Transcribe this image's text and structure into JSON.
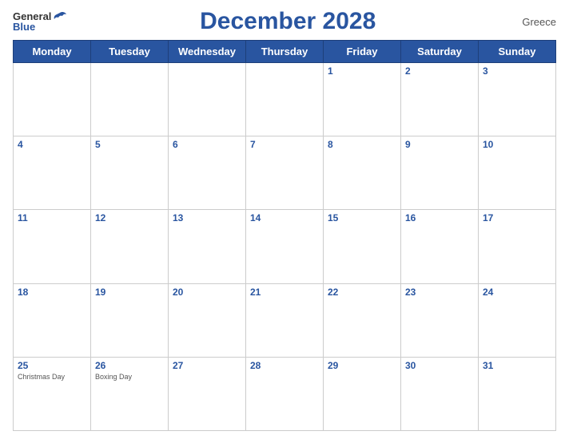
{
  "header": {
    "logo_general": "General",
    "logo_blue": "Blue",
    "title": "December 2028",
    "country": "Greece"
  },
  "days_of_week": [
    "Monday",
    "Tuesday",
    "Wednesday",
    "Thursday",
    "Friday",
    "Saturday",
    "Sunday"
  ],
  "weeks": [
    [
      {
        "day": "",
        "holiday": ""
      },
      {
        "day": "",
        "holiday": ""
      },
      {
        "day": "",
        "holiday": ""
      },
      {
        "day": "",
        "holiday": ""
      },
      {
        "day": "1",
        "holiday": ""
      },
      {
        "day": "2",
        "holiday": ""
      },
      {
        "day": "3",
        "holiday": ""
      }
    ],
    [
      {
        "day": "4",
        "holiday": ""
      },
      {
        "day": "5",
        "holiday": ""
      },
      {
        "day": "6",
        "holiday": ""
      },
      {
        "day": "7",
        "holiday": ""
      },
      {
        "day": "8",
        "holiday": ""
      },
      {
        "day": "9",
        "holiday": ""
      },
      {
        "day": "10",
        "holiday": ""
      }
    ],
    [
      {
        "day": "11",
        "holiday": ""
      },
      {
        "day": "12",
        "holiday": ""
      },
      {
        "day": "13",
        "holiday": ""
      },
      {
        "day": "14",
        "holiday": ""
      },
      {
        "day": "15",
        "holiday": ""
      },
      {
        "day": "16",
        "holiday": ""
      },
      {
        "day": "17",
        "holiday": ""
      }
    ],
    [
      {
        "day": "18",
        "holiday": ""
      },
      {
        "day": "19",
        "holiday": ""
      },
      {
        "day": "20",
        "holiday": ""
      },
      {
        "day": "21",
        "holiday": ""
      },
      {
        "day": "22",
        "holiday": ""
      },
      {
        "day": "23",
        "holiday": ""
      },
      {
        "day": "24",
        "holiday": ""
      }
    ],
    [
      {
        "day": "25",
        "holiday": "Christmas Day"
      },
      {
        "day": "26",
        "holiday": "Boxing Day"
      },
      {
        "day": "27",
        "holiday": ""
      },
      {
        "day": "28",
        "holiday": ""
      },
      {
        "day": "29",
        "holiday": ""
      },
      {
        "day": "30",
        "holiday": ""
      },
      {
        "day": "31",
        "holiday": ""
      }
    ]
  ]
}
